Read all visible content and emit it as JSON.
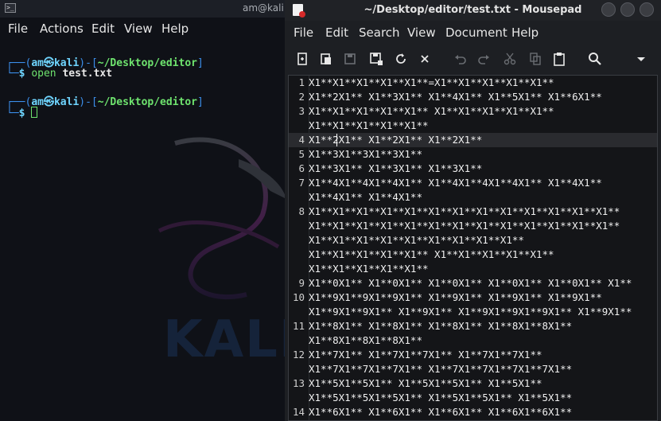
{
  "terminal": {
    "title": "am@kali: ~/",
    "menu": [
      "File",
      "Actions",
      "Edit",
      "View",
      "Help"
    ],
    "watermark": "KALI",
    "lines": [
      {
        "user": "am",
        "host": "kali",
        "path": "~/Desktop/editor",
        "cmd": "open",
        "arg": "test.txt"
      },
      {
        "user": "am",
        "host": "kali",
        "path": "~/Desktop/editor",
        "cmd": "",
        "arg": ""
      }
    ],
    "prompt_symbol": "$"
  },
  "mousepad": {
    "title": "~/Desktop/editor/test.txt - Mousepad",
    "menu": [
      "File",
      "Edit",
      "Search",
      "View",
      "Document",
      "Help"
    ],
    "toolbar": [
      "new-document",
      "new-window",
      "save",
      "save-as",
      "reload",
      "close",
      "undo",
      "redo",
      "cut",
      "copy",
      "paste",
      "find",
      "more"
    ],
    "lines": [
      {
        "n": "1",
        "text": "X1**X1**X1**X1**X1**=X1**X1**X1**X1**X1**"
      },
      {
        "n": "2",
        "text": "X1**2X1** X1**3X1** X1**4X1** X1**5X1** X1**6X1**"
      },
      {
        "n": "3",
        "text": "X1**X1**X1**X1**X1** X1**X1**X1**X1**X1**"
      },
      {
        "n": "",
        "text": "X1**X1**X1**X1**X1**"
      },
      {
        "n": "4",
        "text": "X1**2X1** X1**2X1** X1**2X1**"
      },
      {
        "n": "5",
        "text": "X1**3X1**3X1**3X1**"
      },
      {
        "n": "6",
        "text": "X1**3X1** X1**3X1** X1**3X1**"
      },
      {
        "n": "7",
        "text": "X1**4X1**4X1**4X1** X1**4X1**4X1**4X1** X1**4X1**"
      },
      {
        "n": "",
        "text": "X1**4X1** X1**4X1**"
      },
      {
        "n": "8",
        "text": "X1**X1**X1**X1**X1**X1**X1**X1**X1**X1**X1**X1**X1**"
      },
      {
        "n": "",
        "text": "X1**X1**X1**X1**X1**X1**X1**X1**X1**X1**X1**X1**X1**"
      },
      {
        "n": "",
        "text": "X1**X1**X1**X1**X1**X1**X1**X1**X1**"
      },
      {
        "n": "",
        "text": "X1**X1**X1**X1**X1** X1**X1**X1**X1**X1**"
      },
      {
        "n": "",
        "text": "X1**X1**X1**X1**X1**"
      },
      {
        "n": "9",
        "text": "X1**0X1** X1**0X1** X1**0X1** X1**0X1** X1**0X1** X1**"
      },
      {
        "n": "10",
        "text": "X1**9X1**9X1**9X1** X1**9X1** X1**9X1** X1**9X1**"
      },
      {
        "n": "",
        "text": "X1**9X1**9X1** X1**9X1** X1**9X1**9X1**9X1** X1**9X1**"
      },
      {
        "n": "11",
        "text": "X1**8X1** X1**8X1** X1**8X1** X1**8X1**8X1**"
      },
      {
        "n": "",
        "text": "X1**8X1**8X1**8X1**"
      },
      {
        "n": "12",
        "text": "X1**7X1** X1**7X1**7X1** X1**7X1**7X1**"
      },
      {
        "n": "",
        "text": "X1**7X1**7X1**7X1** X1**7X1**7X1**7X1**7X1**"
      },
      {
        "n": "13",
        "text": "X1**5X1**5X1** X1**5X1**5X1** X1**5X1**"
      },
      {
        "n": "",
        "text": "X1**5X1**5X1**5X1** X1**5X1**5X1** X1**5X1**"
      },
      {
        "n": "14",
        "text": "X1**6X1** X1**6X1** X1**6X1** X1**6X1**6X1**"
      }
    ],
    "current_line_index": 4
  },
  "colors": {
    "terminal_bg": "#0f1117",
    "editor_bg": "#141518",
    "prompt_blue": "#3b8eea",
    "path_green": "#6ee36e"
  }
}
